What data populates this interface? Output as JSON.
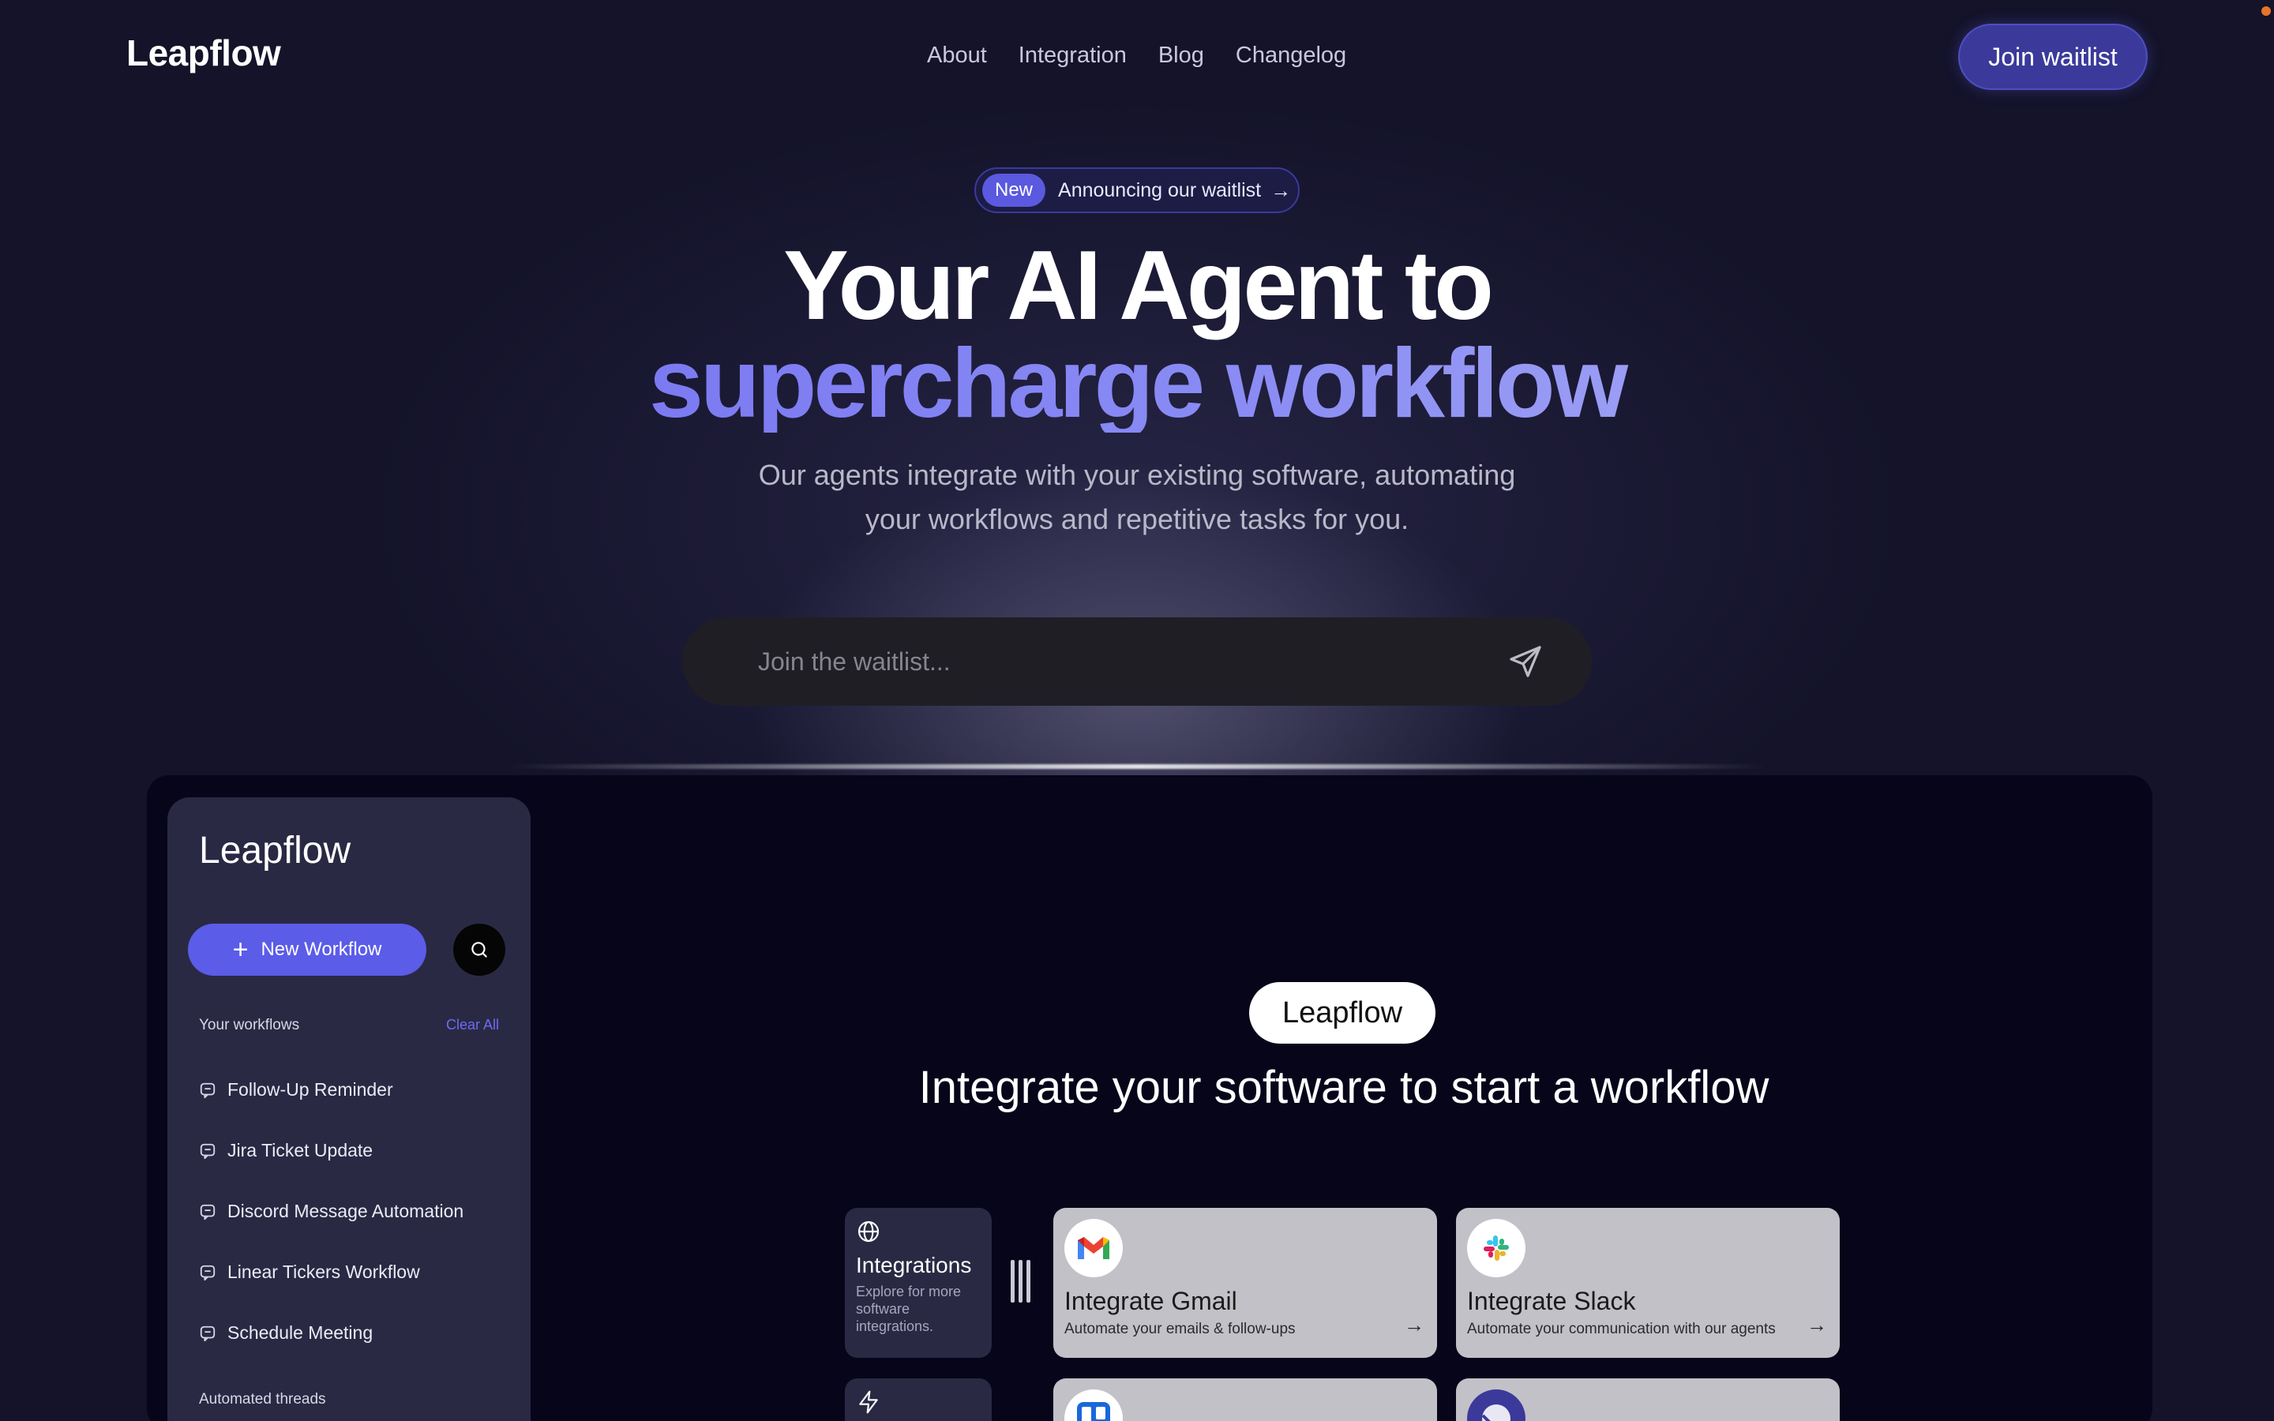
{
  "nav": {
    "brand": "Leapflow",
    "links": [
      "About",
      "Integration",
      "Blog",
      "Changelog"
    ],
    "cta": "Join waitlist"
  },
  "announce": {
    "tag": "New",
    "text": "Announcing our waitlist",
    "arrow": "→"
  },
  "hero": {
    "line1": "Your AI Agent to",
    "line2": "supercharge workflow",
    "subtitle_line1": "Our agents integrate with your existing software, automating",
    "subtitle_line2": "your workflows and repetitive tasks for you."
  },
  "waitlist": {
    "placeholder": "Join the waitlist...",
    "submit_icon": "send-icon"
  },
  "preview": {
    "sidebar": {
      "brand": "Leapflow",
      "new_workflow": "New Workflow",
      "section_title": "Your workflows",
      "clear_all": "Clear All",
      "workflows": [
        "Follow-Up Reminder",
        "Jira Ticket Update",
        "Discord Message Automation",
        "Linear Tickers Workflow",
        "Schedule Meeting"
      ],
      "section2_title": "Automated threads"
    },
    "main": {
      "pill": "Leapflow",
      "title": "Integrate your software to start a workflow",
      "integrations_card": {
        "title": "Integrations",
        "desc": "Explore for more software integrations."
      },
      "apps": [
        {
          "name": "Integrate Gmail",
          "tagline": "Automate your emails & follow-ups"
        },
        {
          "name": "Integrate Slack",
          "tagline": "Automate your communication with our agents"
        }
      ]
    }
  },
  "colors": {
    "background": "#14132a",
    "accent": "#5b5ce8",
    "cta": "#3b3a9a",
    "preview_bg": "#07051a",
    "sidebar_bg": "#2a2944"
  }
}
